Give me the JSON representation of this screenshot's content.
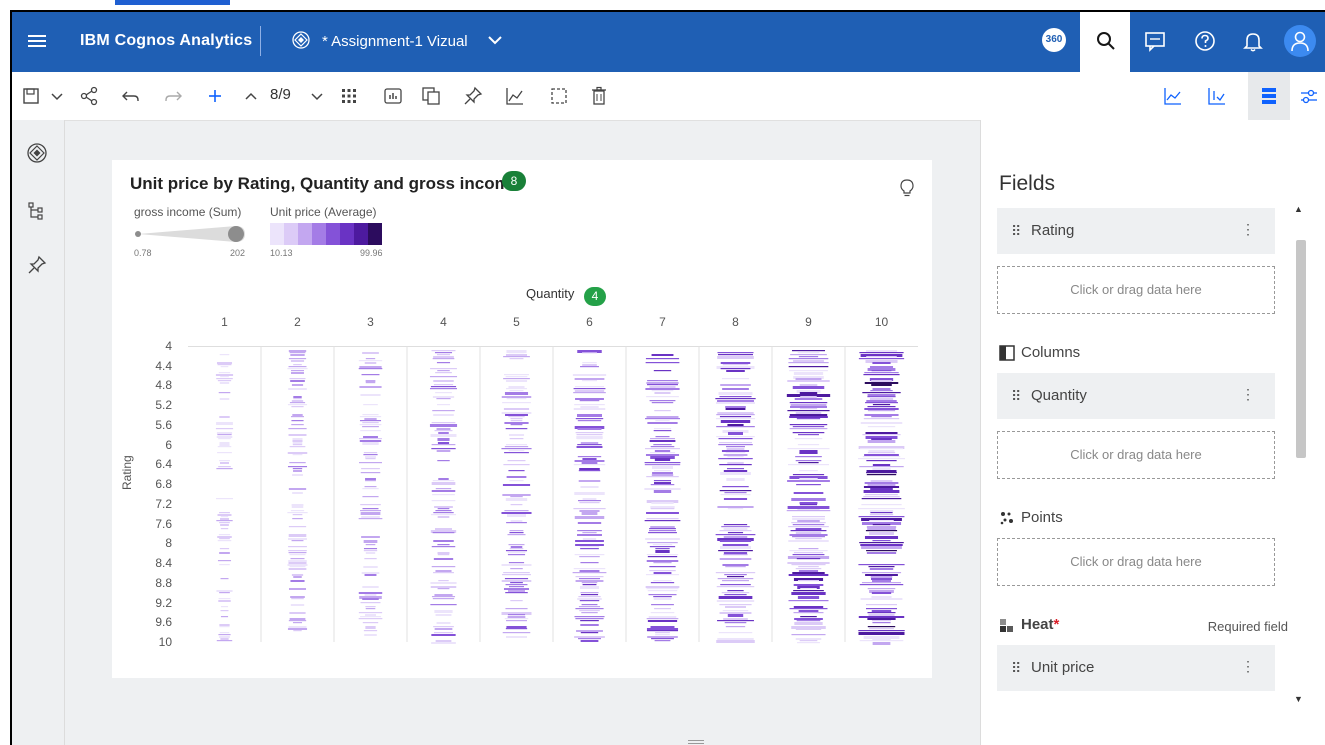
{
  "app": {
    "brand": "IBM Cognos Analytics",
    "dashboard_title": "* Assignment-1 Vizual",
    "badge_360": "360"
  },
  "toolbar": {
    "page_counter": "8/9"
  },
  "card": {
    "title": "Unit price by Rating, Quantity and gross income",
    "title_badge": "8",
    "size_legend": {
      "title": "gross income (Sum)",
      "min": "0.78",
      "max": "202"
    },
    "heat_legend": {
      "title": "Unit price (Average)",
      "min": "10.13",
      "max": "99.96",
      "colors": [
        "#ece4fb",
        "#dccbf7",
        "#c3a7f0",
        "#a47ce6",
        "#8452d8",
        "#6a33c4",
        "#4d1a9f",
        "#2c0c5e"
      ]
    },
    "columns_axis": {
      "label": "Quantity",
      "badge": "4"
    },
    "rows_axis": {
      "label": "Rating"
    }
  },
  "chart_data": {
    "type": "heatmap",
    "title": "Unit price by Rating, Quantity and gross income",
    "x_title": "Quantity",
    "y_title": "Rating",
    "x": [
      "1",
      "2",
      "3",
      "4",
      "5",
      "6",
      "7",
      "8",
      "9",
      "10"
    ],
    "y": [
      "4",
      "4.4",
      "4.8",
      "5.2",
      "5.6",
      "6",
      "6.4",
      "6.8",
      "7.2",
      "7.6",
      "8",
      "8.4",
      "8.8",
      "9.2",
      "9.6",
      "10"
    ],
    "size_measure": "gross income (Sum)",
    "color_measure": "Unit price (Average)",
    "size_range": [
      0.78,
      202
    ],
    "color_range": [
      10.13,
      99.96
    ]
  },
  "panel": {
    "title": "Fields",
    "rows_field": "Rating",
    "drop_hint": "Click or drag data here",
    "columns_label": "Columns",
    "columns_field": "Quantity",
    "points_label": "Points",
    "heat_label": "Heat",
    "required_star": "*",
    "required_text": "Required field",
    "heat_field": "Unit price"
  }
}
